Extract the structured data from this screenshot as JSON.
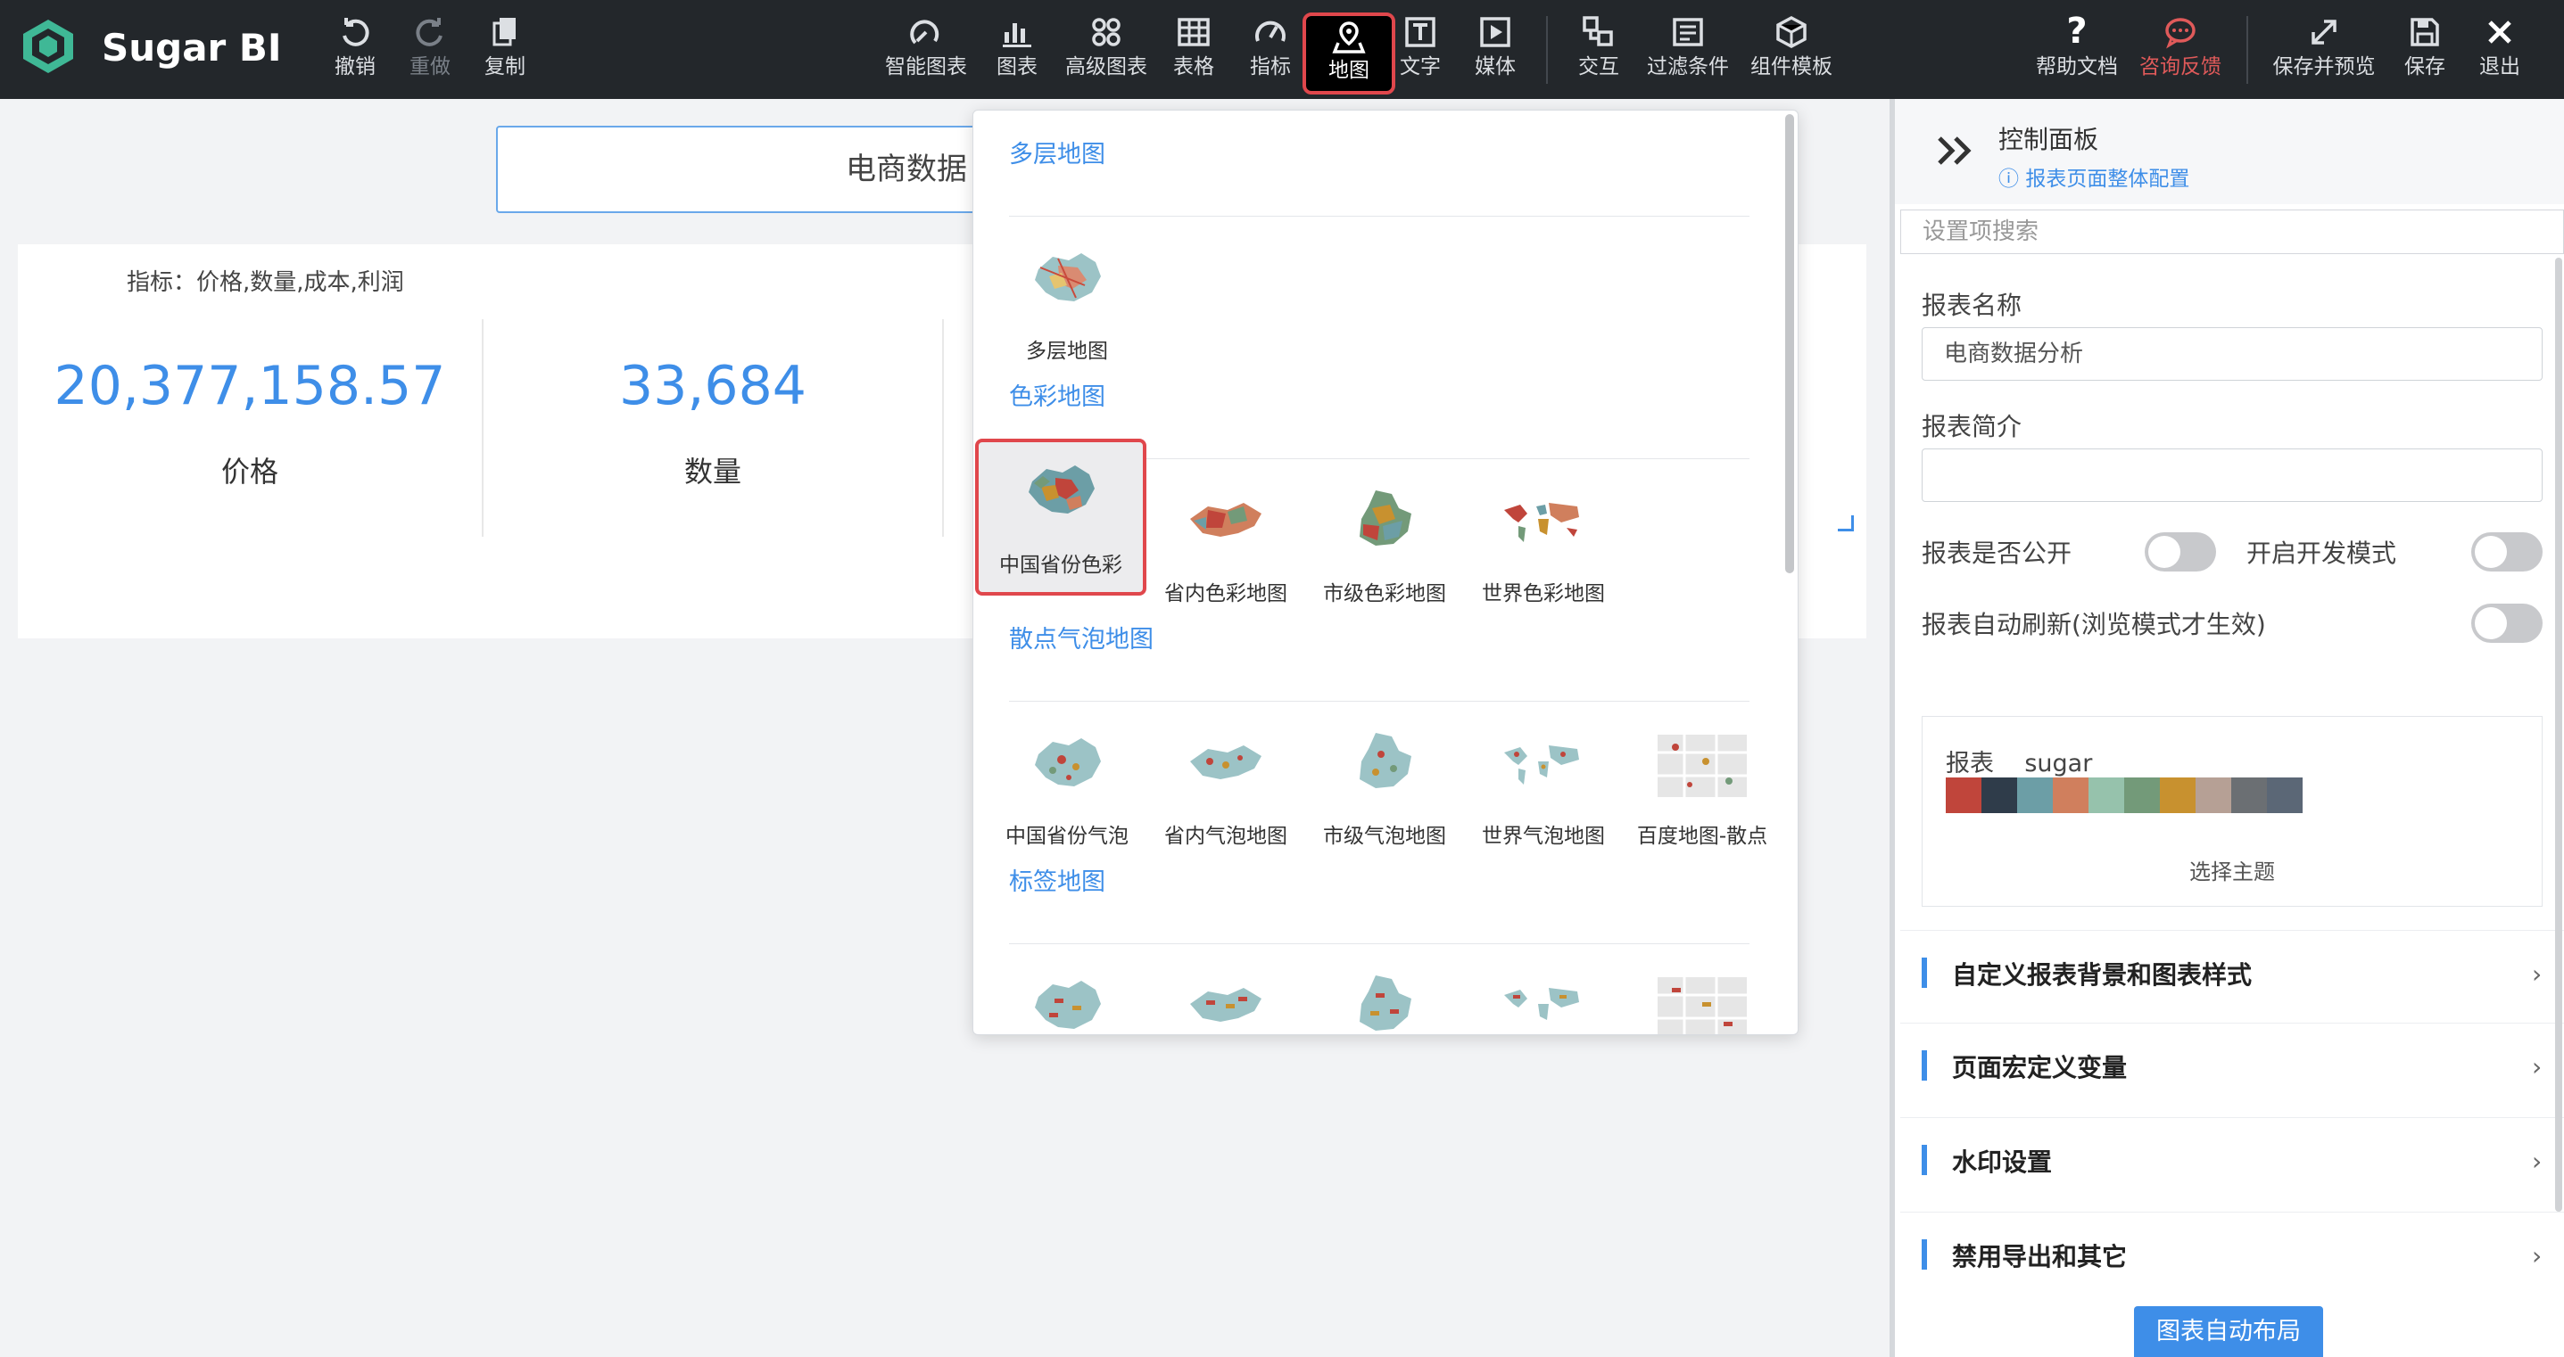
{
  "app": {
    "brand": "Sugar BI"
  },
  "toolbar": {
    "left": [
      {
        "id": "undo",
        "label": "撤销",
        "icon": "undo-icon"
      },
      {
        "id": "redo",
        "label": "重做",
        "icon": "redo-icon",
        "disabled": true
      },
      {
        "id": "copy",
        "label": "复制",
        "icon": "copy-icon"
      }
    ],
    "center": [
      {
        "id": "smart-chart",
        "label": "智能图表",
        "icon": "smart-chart-icon"
      },
      {
        "id": "chart",
        "label": "图表",
        "icon": "bar-chart-icon"
      },
      {
        "id": "advanced-chart",
        "label": "高级图表",
        "icon": "advanced-chart-icon"
      },
      {
        "id": "table",
        "label": "表格",
        "icon": "table-icon"
      },
      {
        "id": "indicator",
        "label": "指标",
        "icon": "gauge-icon"
      },
      {
        "id": "map",
        "label": "地图",
        "icon": "map-pin-icon",
        "active": true
      },
      {
        "id": "text",
        "label": "文字",
        "icon": "text-icon"
      },
      {
        "id": "media",
        "label": "媒体",
        "icon": "media-icon"
      },
      {
        "id": "interact",
        "label": "交互",
        "icon": "interact-icon"
      },
      {
        "id": "filter",
        "label": "过滤条件",
        "icon": "filter-icon"
      },
      {
        "id": "template",
        "label": "组件模板",
        "icon": "template-icon"
      }
    ],
    "right": [
      {
        "id": "help",
        "label": "帮助文档",
        "icon": "help-icon"
      },
      {
        "id": "consult",
        "label": "咨询反馈",
        "icon": "chat-icon"
      },
      {
        "id": "save-preview",
        "label": "保存并预览",
        "icon": "expand-icon"
      },
      {
        "id": "save",
        "label": "保存",
        "icon": "save-icon"
      },
      {
        "id": "exit",
        "label": "退出",
        "icon": "close-icon"
      }
    ]
  },
  "canvas": {
    "report_title": "电商数据",
    "kpi": {
      "indicators": "指标：价格,数量,成本,利润",
      "items": [
        {
          "value": "20,377,158.57",
          "name": "价格"
        },
        {
          "value": "33,684",
          "name": "数量"
        }
      ]
    }
  },
  "map_menu": {
    "sections": [
      {
        "title": "多层地图",
        "items": [
          {
            "label": "多层地图",
            "thumb": "multilayer"
          }
        ]
      },
      {
        "title": "色彩地图",
        "items": [
          {
            "label": "中国省份色彩",
            "thumb": "china-color",
            "selected": true
          },
          {
            "label": "省内色彩地图",
            "thumb": "province-color"
          },
          {
            "label": "市级色彩地图",
            "thumb": "city-color"
          },
          {
            "label": "世界色彩地图",
            "thumb": "world-color"
          }
        ]
      },
      {
        "title": "散点气泡地图",
        "items": [
          {
            "label": "中国省份气泡",
            "thumb": "china-bubble"
          },
          {
            "label": "省内气泡地图",
            "thumb": "province-bubble"
          },
          {
            "label": "市级气泡地图",
            "thumb": "city-bubble"
          },
          {
            "label": "世界气泡地图",
            "thumb": "world-bubble"
          },
          {
            "label": "百度地图-散点",
            "thumb": "baidu-scatter"
          }
        ]
      },
      {
        "title": "标签地图",
        "items": [
          {
            "label": "",
            "thumb": "china-tag"
          },
          {
            "label": "",
            "thumb": "province-tag"
          },
          {
            "label": "",
            "thumb": "city-tag"
          },
          {
            "label": "",
            "thumb": "world-tag"
          },
          {
            "label": "",
            "thumb": "baidu-tag"
          }
        ]
      }
    ]
  },
  "panel": {
    "title": "控制面板",
    "config_link": "报表页面整体配置",
    "search_placeholder": "设置项搜索",
    "report_name_label": "报表名称",
    "report_name_value": "电商数据分析",
    "report_desc_label": "报表简介",
    "report_desc_value": "",
    "public_label": "报表是否公开",
    "dev_mode_label": "开启开发模式",
    "auto_refresh_label": "报表自动刷新(浏览模式才生效)",
    "theme": {
      "type_label": "报表",
      "name": "sugar",
      "colors": [
        "#c0453b",
        "#2f3c4a",
        "#6c9ea6",
        "#d07f5d",
        "#96c2ac",
        "#739a79",
        "#c8912f",
        "#b6a095",
        "#6b6f73",
        "#5b6776"
      ],
      "button": "选择主题"
    },
    "accordions": [
      "自定义报表背景和图表样式",
      "页面宏定义变量",
      "水印设置",
      "禁用导出和其它"
    ],
    "auto_layout": "图表自动布局"
  },
  "colors": {
    "toolbar_bg": "#23272b",
    "accent": "#3e8ee8",
    "highlight": "#e0474c"
  }
}
